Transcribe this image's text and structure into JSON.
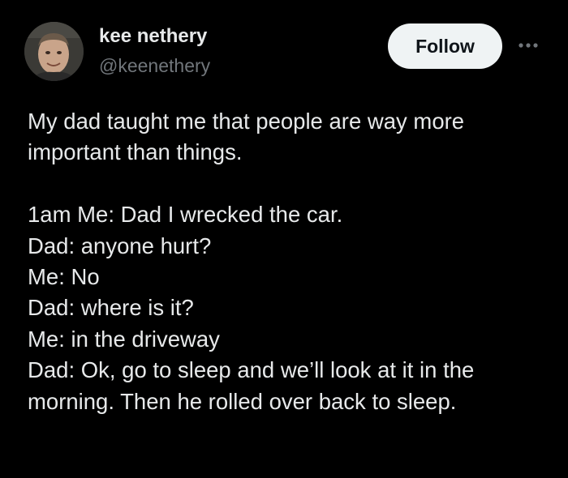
{
  "author": {
    "display_name": "kee nethery",
    "handle": "@keenethery",
    "avatar_icon": "profile-photo"
  },
  "actions": {
    "follow_label": "Follow",
    "more_icon": "more-horizontal-icon"
  },
  "tweet": {
    "lines": [
      "My dad taught me that people are way more",
      "important than things.",
      "",
      "1am Me: Dad I wrecked the car.",
      "Dad: anyone hurt?",
      "Me: No",
      "Dad: where is it?",
      "Me: in the driveway",
      "Dad: Ok, go to sleep and we’ll look at it in the",
      "morning. Then he rolled over back to sleep."
    ]
  },
  "colors": {
    "background": "#000000",
    "primary_text": "#e7e9ea",
    "secondary_text": "#71767b",
    "follow_bg": "#eff3f4",
    "follow_text": "#0f1419"
  }
}
